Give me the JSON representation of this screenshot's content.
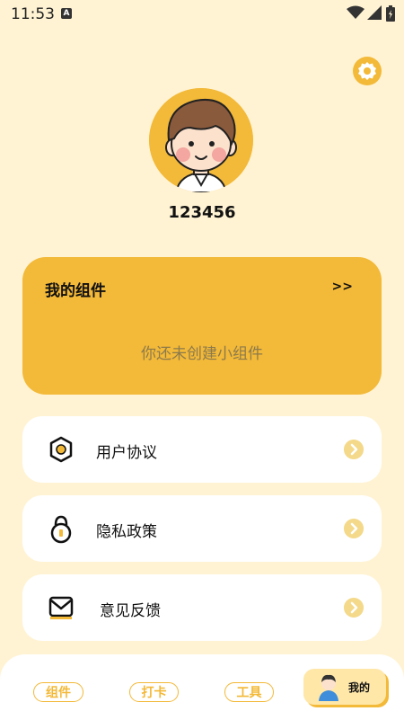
{
  "status_bar": {
    "time": "11:53",
    "notification_icon": "A"
  },
  "profile": {
    "username": "123456"
  },
  "widget_card": {
    "title": "我的组件",
    "more": ">>",
    "empty_text": "你还未创建小组件"
  },
  "menu": [
    {
      "label": "用户协议",
      "icon": "hexagon-agreement-icon"
    },
    {
      "label": "隐私政策",
      "icon": "lock-privacy-icon"
    },
    {
      "label": "意见反馈",
      "icon": "mail-feedback-icon"
    }
  ],
  "bottom_nav": {
    "tabs": [
      {
        "label": "组件"
      },
      {
        "label": "打卡"
      },
      {
        "label": "工具"
      },
      {
        "label": "我的",
        "active": true
      }
    ]
  },
  "colors": {
    "background": "#FFF3D3",
    "accent": "#F3B938",
    "card": "#FFFFFF"
  }
}
